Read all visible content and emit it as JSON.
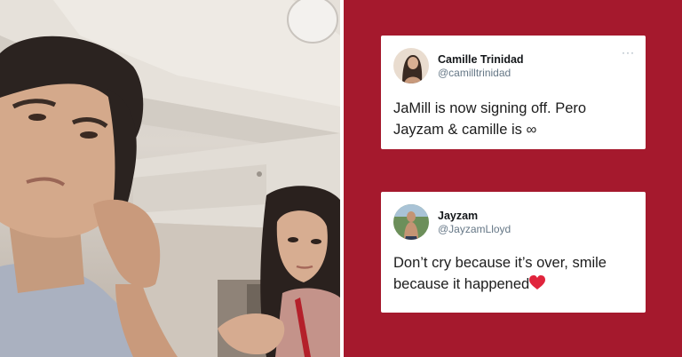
{
  "tweets": [
    {
      "display_name": "Camille Trinidad",
      "handle": "@camilltrinidad",
      "more": "···",
      "text": "JaMill is now signing off. Pero Jayzam & camille is ∞",
      "avatar": "woman-portrait-avatar"
    },
    {
      "display_name": "Jayzam",
      "handle": "@JayzamLloyd",
      "text": "Don’t cry because it’s over, smile because it happened",
      "emoji": "red-heart-icon",
      "avatar": "man-outdoor-avatar"
    }
  ],
  "colors": {
    "panel_background": "#a5192d",
    "card_background": "#ffffff",
    "heart": "#e0243c"
  }
}
